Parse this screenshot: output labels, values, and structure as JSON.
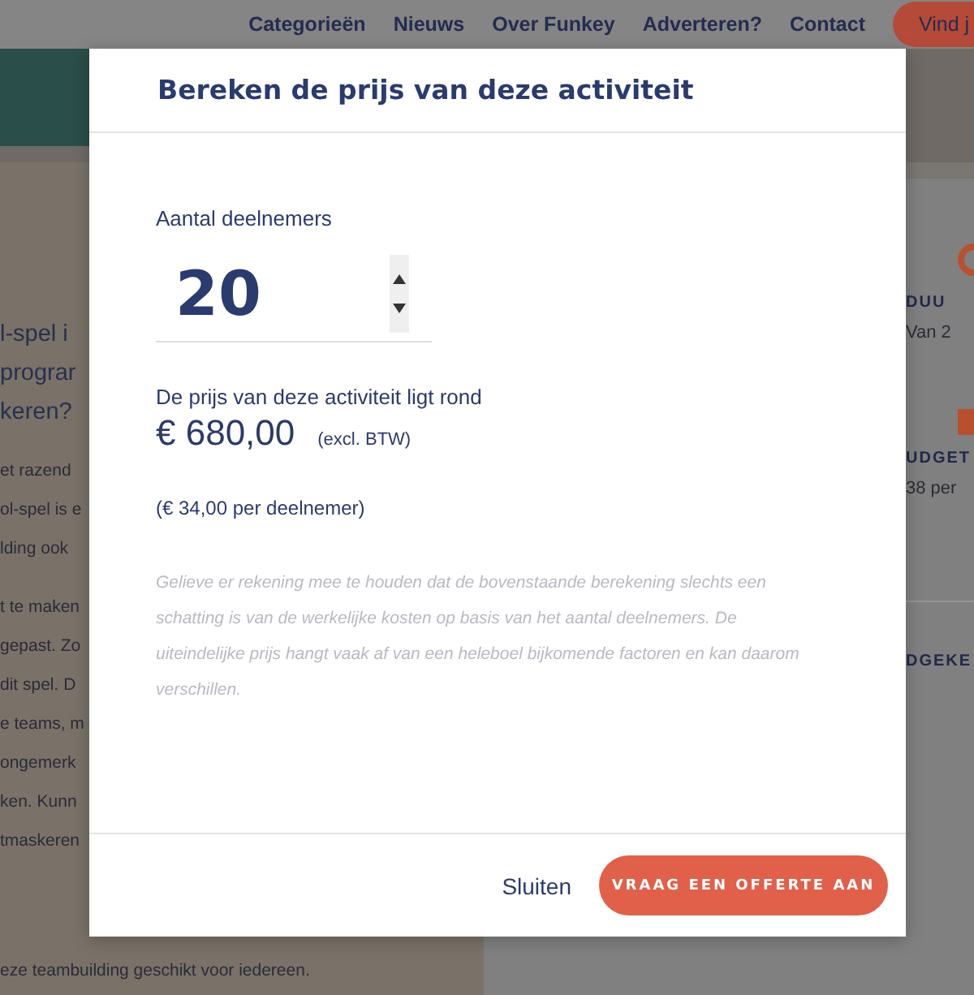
{
  "nav": {
    "links": [
      "Categorieën",
      "Nieuws",
      "Over Funkey",
      "Adverteren?",
      "Contact"
    ],
    "cta": "Vind j"
  },
  "background": {
    "left": {
      "heading": [
        "l-spel i",
        "prograr",
        "keren?"
      ],
      "paragraph_1": [
        "et razend",
        "ol-spel is e",
        "lding ook"
      ],
      "paragraph_2": [
        "t te maken",
        "gepast. Zo",
        "dit spel. D",
        "e teams, m",
        "ongemerk",
        "ken. Kunn",
        "tmaskeren"
      ],
      "closing_line": "eze teambuilding geschikt voor iedereen."
    },
    "right": {
      "duration_label": "DUU",
      "duration_value": "Van 2",
      "budget_label": "UDGET",
      "budget_value": "38 per",
      "reviews_label": "DGEKE"
    }
  },
  "modal": {
    "title": "Bereken de prijs van deze activiteit",
    "quantity": {
      "label": "Aantal deelnemers",
      "value": "20"
    },
    "price": {
      "intro": "De prijs van deze activiteit ligt rond",
      "amount": "€ 680,00",
      "note": "(excl. BTW)",
      "per_person": "(€ 34,00 per deelnemer)"
    },
    "disclaimer": "Gelieve er rekening mee te houden dat de bovenstaande berekening slechts een schatting is van de werkelijke kosten op basis van het aantal deelnemers. De uiteindelijke prijs hangt vaak af van een heleboel bijkomende factoren en kan daarom verschillen.",
    "close": "Sluiten",
    "cta": "VRAAG EEN OFFERTE AAN"
  }
}
